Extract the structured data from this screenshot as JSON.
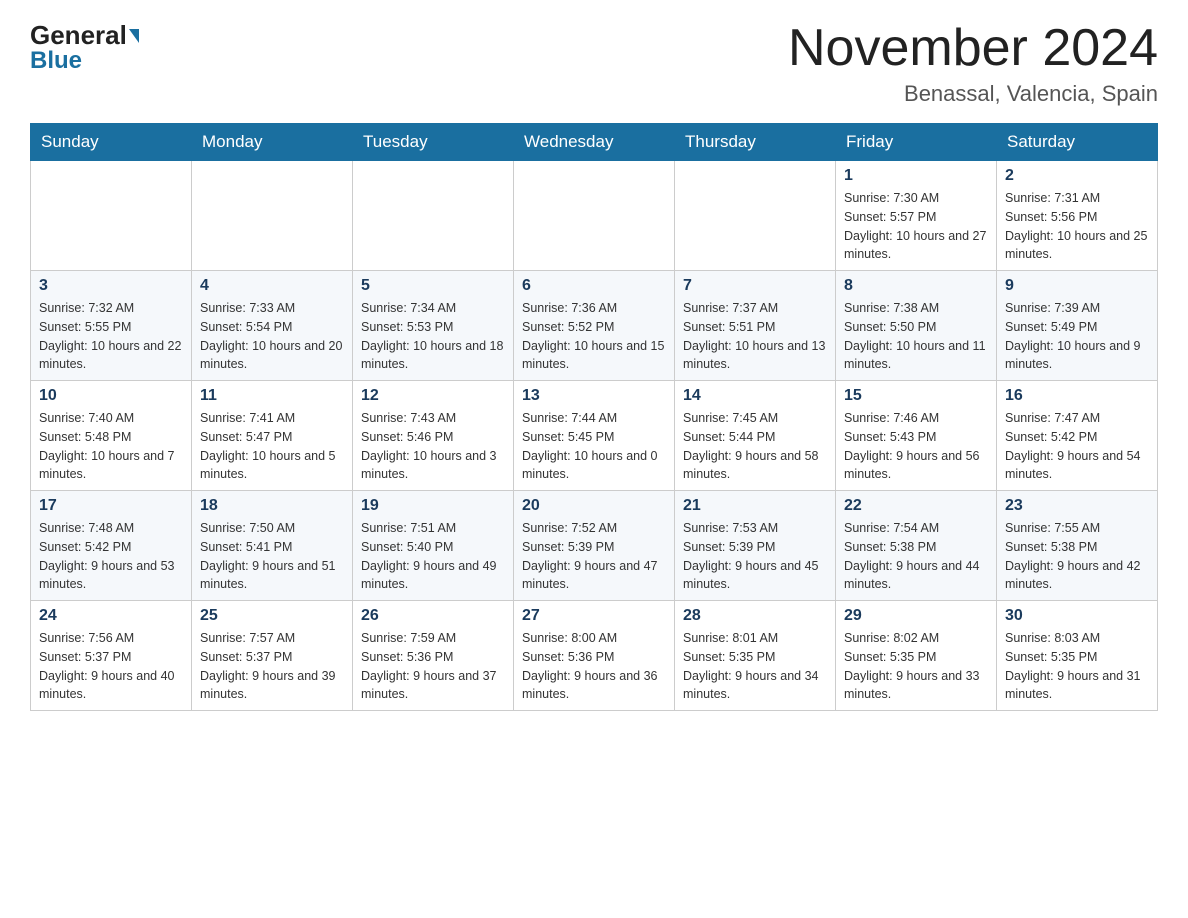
{
  "header": {
    "logo_general": "General",
    "logo_blue": "Blue",
    "title": "November 2024",
    "subtitle": "Benassal, Valencia, Spain"
  },
  "weekdays": [
    "Sunday",
    "Monday",
    "Tuesday",
    "Wednesday",
    "Thursday",
    "Friday",
    "Saturday"
  ],
  "rows": [
    {
      "cells": [
        {
          "day": "",
          "sunrise": "",
          "sunset": "",
          "daylight": ""
        },
        {
          "day": "",
          "sunrise": "",
          "sunset": "",
          "daylight": ""
        },
        {
          "day": "",
          "sunrise": "",
          "sunset": "",
          "daylight": ""
        },
        {
          "day": "",
          "sunrise": "",
          "sunset": "",
          "daylight": ""
        },
        {
          "day": "",
          "sunrise": "",
          "sunset": "",
          "daylight": ""
        },
        {
          "day": "1",
          "sunrise": "Sunrise: 7:30 AM",
          "sunset": "Sunset: 5:57 PM",
          "daylight": "Daylight: 10 hours and 27 minutes."
        },
        {
          "day": "2",
          "sunrise": "Sunrise: 7:31 AM",
          "sunset": "Sunset: 5:56 PM",
          "daylight": "Daylight: 10 hours and 25 minutes."
        }
      ]
    },
    {
      "cells": [
        {
          "day": "3",
          "sunrise": "Sunrise: 7:32 AM",
          "sunset": "Sunset: 5:55 PM",
          "daylight": "Daylight: 10 hours and 22 minutes."
        },
        {
          "day": "4",
          "sunrise": "Sunrise: 7:33 AM",
          "sunset": "Sunset: 5:54 PM",
          "daylight": "Daylight: 10 hours and 20 minutes."
        },
        {
          "day": "5",
          "sunrise": "Sunrise: 7:34 AM",
          "sunset": "Sunset: 5:53 PM",
          "daylight": "Daylight: 10 hours and 18 minutes."
        },
        {
          "day": "6",
          "sunrise": "Sunrise: 7:36 AM",
          "sunset": "Sunset: 5:52 PM",
          "daylight": "Daylight: 10 hours and 15 minutes."
        },
        {
          "day": "7",
          "sunrise": "Sunrise: 7:37 AM",
          "sunset": "Sunset: 5:51 PM",
          "daylight": "Daylight: 10 hours and 13 minutes."
        },
        {
          "day": "8",
          "sunrise": "Sunrise: 7:38 AM",
          "sunset": "Sunset: 5:50 PM",
          "daylight": "Daylight: 10 hours and 11 minutes."
        },
        {
          "day": "9",
          "sunrise": "Sunrise: 7:39 AM",
          "sunset": "Sunset: 5:49 PM",
          "daylight": "Daylight: 10 hours and 9 minutes."
        }
      ]
    },
    {
      "cells": [
        {
          "day": "10",
          "sunrise": "Sunrise: 7:40 AM",
          "sunset": "Sunset: 5:48 PM",
          "daylight": "Daylight: 10 hours and 7 minutes."
        },
        {
          "day": "11",
          "sunrise": "Sunrise: 7:41 AM",
          "sunset": "Sunset: 5:47 PM",
          "daylight": "Daylight: 10 hours and 5 minutes."
        },
        {
          "day": "12",
          "sunrise": "Sunrise: 7:43 AM",
          "sunset": "Sunset: 5:46 PM",
          "daylight": "Daylight: 10 hours and 3 minutes."
        },
        {
          "day": "13",
          "sunrise": "Sunrise: 7:44 AM",
          "sunset": "Sunset: 5:45 PM",
          "daylight": "Daylight: 10 hours and 0 minutes."
        },
        {
          "day": "14",
          "sunrise": "Sunrise: 7:45 AM",
          "sunset": "Sunset: 5:44 PM",
          "daylight": "Daylight: 9 hours and 58 minutes."
        },
        {
          "day": "15",
          "sunrise": "Sunrise: 7:46 AM",
          "sunset": "Sunset: 5:43 PM",
          "daylight": "Daylight: 9 hours and 56 minutes."
        },
        {
          "day": "16",
          "sunrise": "Sunrise: 7:47 AM",
          "sunset": "Sunset: 5:42 PM",
          "daylight": "Daylight: 9 hours and 54 minutes."
        }
      ]
    },
    {
      "cells": [
        {
          "day": "17",
          "sunrise": "Sunrise: 7:48 AM",
          "sunset": "Sunset: 5:42 PM",
          "daylight": "Daylight: 9 hours and 53 minutes."
        },
        {
          "day": "18",
          "sunrise": "Sunrise: 7:50 AM",
          "sunset": "Sunset: 5:41 PM",
          "daylight": "Daylight: 9 hours and 51 minutes."
        },
        {
          "day": "19",
          "sunrise": "Sunrise: 7:51 AM",
          "sunset": "Sunset: 5:40 PM",
          "daylight": "Daylight: 9 hours and 49 minutes."
        },
        {
          "day": "20",
          "sunrise": "Sunrise: 7:52 AM",
          "sunset": "Sunset: 5:39 PM",
          "daylight": "Daylight: 9 hours and 47 minutes."
        },
        {
          "day": "21",
          "sunrise": "Sunrise: 7:53 AM",
          "sunset": "Sunset: 5:39 PM",
          "daylight": "Daylight: 9 hours and 45 minutes."
        },
        {
          "day": "22",
          "sunrise": "Sunrise: 7:54 AM",
          "sunset": "Sunset: 5:38 PM",
          "daylight": "Daylight: 9 hours and 44 minutes."
        },
        {
          "day": "23",
          "sunrise": "Sunrise: 7:55 AM",
          "sunset": "Sunset: 5:38 PM",
          "daylight": "Daylight: 9 hours and 42 minutes."
        }
      ]
    },
    {
      "cells": [
        {
          "day": "24",
          "sunrise": "Sunrise: 7:56 AM",
          "sunset": "Sunset: 5:37 PM",
          "daylight": "Daylight: 9 hours and 40 minutes."
        },
        {
          "day": "25",
          "sunrise": "Sunrise: 7:57 AM",
          "sunset": "Sunset: 5:37 PM",
          "daylight": "Daylight: 9 hours and 39 minutes."
        },
        {
          "day": "26",
          "sunrise": "Sunrise: 7:59 AM",
          "sunset": "Sunset: 5:36 PM",
          "daylight": "Daylight: 9 hours and 37 minutes."
        },
        {
          "day": "27",
          "sunrise": "Sunrise: 8:00 AM",
          "sunset": "Sunset: 5:36 PM",
          "daylight": "Daylight: 9 hours and 36 minutes."
        },
        {
          "day": "28",
          "sunrise": "Sunrise: 8:01 AM",
          "sunset": "Sunset: 5:35 PM",
          "daylight": "Daylight: 9 hours and 34 minutes."
        },
        {
          "day": "29",
          "sunrise": "Sunrise: 8:02 AM",
          "sunset": "Sunset: 5:35 PM",
          "daylight": "Daylight: 9 hours and 33 minutes."
        },
        {
          "day": "30",
          "sunrise": "Sunrise: 8:03 AM",
          "sunset": "Sunset: 5:35 PM",
          "daylight": "Daylight: 9 hours and 31 minutes."
        }
      ]
    }
  ]
}
